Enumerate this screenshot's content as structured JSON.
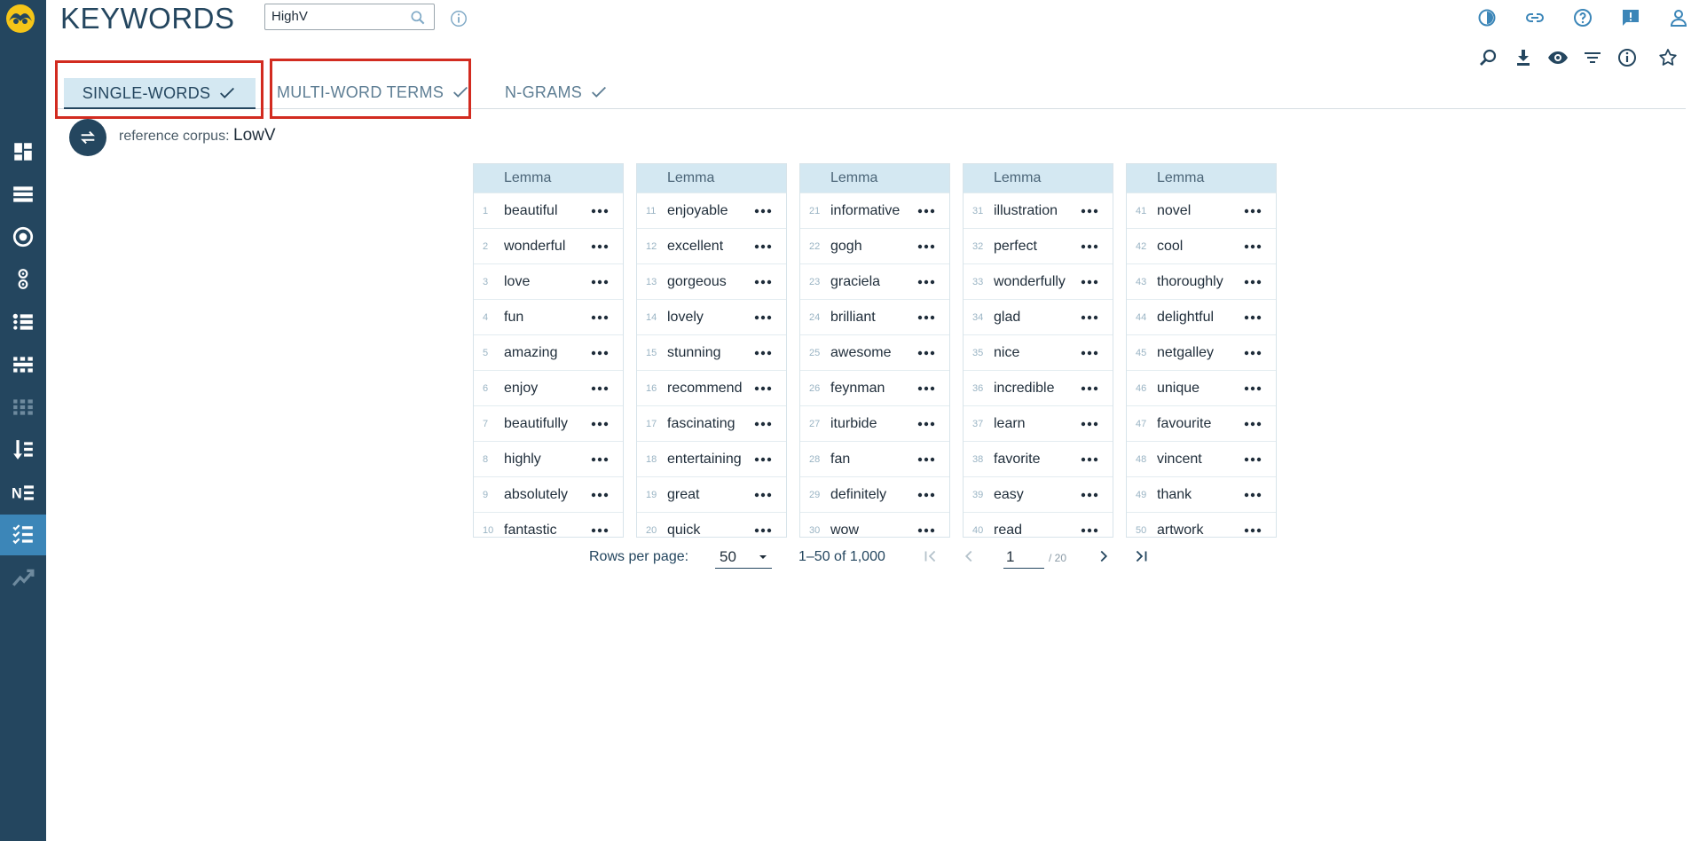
{
  "app": {
    "title": "KEYWORDS"
  },
  "search": {
    "value": "HighV"
  },
  "sidebar": {
    "items": [
      {
        "icon": "dashboard-icon"
      },
      {
        "icon": "list-icon"
      },
      {
        "icon": "target-icon"
      },
      {
        "icon": "circles-icon"
      },
      {
        "icon": "bullets-icon"
      },
      {
        "icon": "grid-dots-icon"
      },
      {
        "icon": "grid-dots-faded-icon"
      },
      {
        "icon": "sort-icon"
      },
      {
        "icon": "ne-icon"
      },
      {
        "icon": "keywords-icon",
        "active": true
      },
      {
        "icon": "trend-icon"
      }
    ]
  },
  "tabs": [
    {
      "label": "SINGLE-WORDS",
      "active": true
    },
    {
      "label": "MULTI-WORD TERMS",
      "active": false
    },
    {
      "label": "N-GRAMS",
      "active": false
    }
  ],
  "reference": {
    "label": "reference corpus:",
    "value": "LowV"
  },
  "table": {
    "header": "Lemma",
    "columns": [
      [
        {
          "n": "1",
          "w": "beautiful"
        },
        {
          "n": "2",
          "w": "wonderful"
        },
        {
          "n": "3",
          "w": "love"
        },
        {
          "n": "4",
          "w": "fun"
        },
        {
          "n": "5",
          "w": "amazing"
        },
        {
          "n": "6",
          "w": "enjoy"
        },
        {
          "n": "7",
          "w": "beautifully"
        },
        {
          "n": "8",
          "w": "highly"
        },
        {
          "n": "9",
          "w": "absolutely"
        },
        {
          "n": "10",
          "w": "fantastic"
        }
      ],
      [
        {
          "n": "11",
          "w": "enjoyable"
        },
        {
          "n": "12",
          "w": "excellent"
        },
        {
          "n": "13",
          "w": "gorgeous"
        },
        {
          "n": "14",
          "w": "lovely"
        },
        {
          "n": "15",
          "w": "stunning"
        },
        {
          "n": "16",
          "w": "recommend"
        },
        {
          "n": "17",
          "w": "fascinating"
        },
        {
          "n": "18",
          "w": "entertaining"
        },
        {
          "n": "19",
          "w": "great"
        },
        {
          "n": "20",
          "w": "quick"
        }
      ],
      [
        {
          "n": "21",
          "w": "informative"
        },
        {
          "n": "22",
          "w": "gogh"
        },
        {
          "n": "23",
          "w": "graciela"
        },
        {
          "n": "24",
          "w": "brilliant"
        },
        {
          "n": "25",
          "w": "awesome"
        },
        {
          "n": "26",
          "w": "feynman"
        },
        {
          "n": "27",
          "w": "iturbide"
        },
        {
          "n": "28",
          "w": "fan"
        },
        {
          "n": "29",
          "w": "definitely"
        },
        {
          "n": "30",
          "w": "wow"
        }
      ],
      [
        {
          "n": "31",
          "w": "illustration"
        },
        {
          "n": "32",
          "w": "perfect"
        },
        {
          "n": "33",
          "w": "wonderfully"
        },
        {
          "n": "34",
          "w": "glad"
        },
        {
          "n": "35",
          "w": "nice"
        },
        {
          "n": "36",
          "w": "incredible"
        },
        {
          "n": "37",
          "w": "learn"
        },
        {
          "n": "38",
          "w": "favorite"
        },
        {
          "n": "39",
          "w": "easy"
        },
        {
          "n": "40",
          "w": "read"
        }
      ],
      [
        {
          "n": "41",
          "w": "novel"
        },
        {
          "n": "42",
          "w": "cool"
        },
        {
          "n": "43",
          "w": "thoroughly"
        },
        {
          "n": "44",
          "w": "delightful"
        },
        {
          "n": "45",
          "w": "netgalley"
        },
        {
          "n": "46",
          "w": "unique"
        },
        {
          "n": "47",
          "w": "favourite"
        },
        {
          "n": "48",
          "w": "vincent"
        },
        {
          "n": "49",
          "w": "thank"
        },
        {
          "n": "50",
          "w": "artwork"
        }
      ]
    ]
  },
  "pagination": {
    "rows_label": "Rows per page:",
    "rows_value": "50",
    "range": "1–50 of 1,000",
    "page": "1",
    "total": "/ 20"
  },
  "colors": {
    "sidebar": "#24465f",
    "accent": "#3c86b8",
    "highlight": "#d22b20"
  }
}
